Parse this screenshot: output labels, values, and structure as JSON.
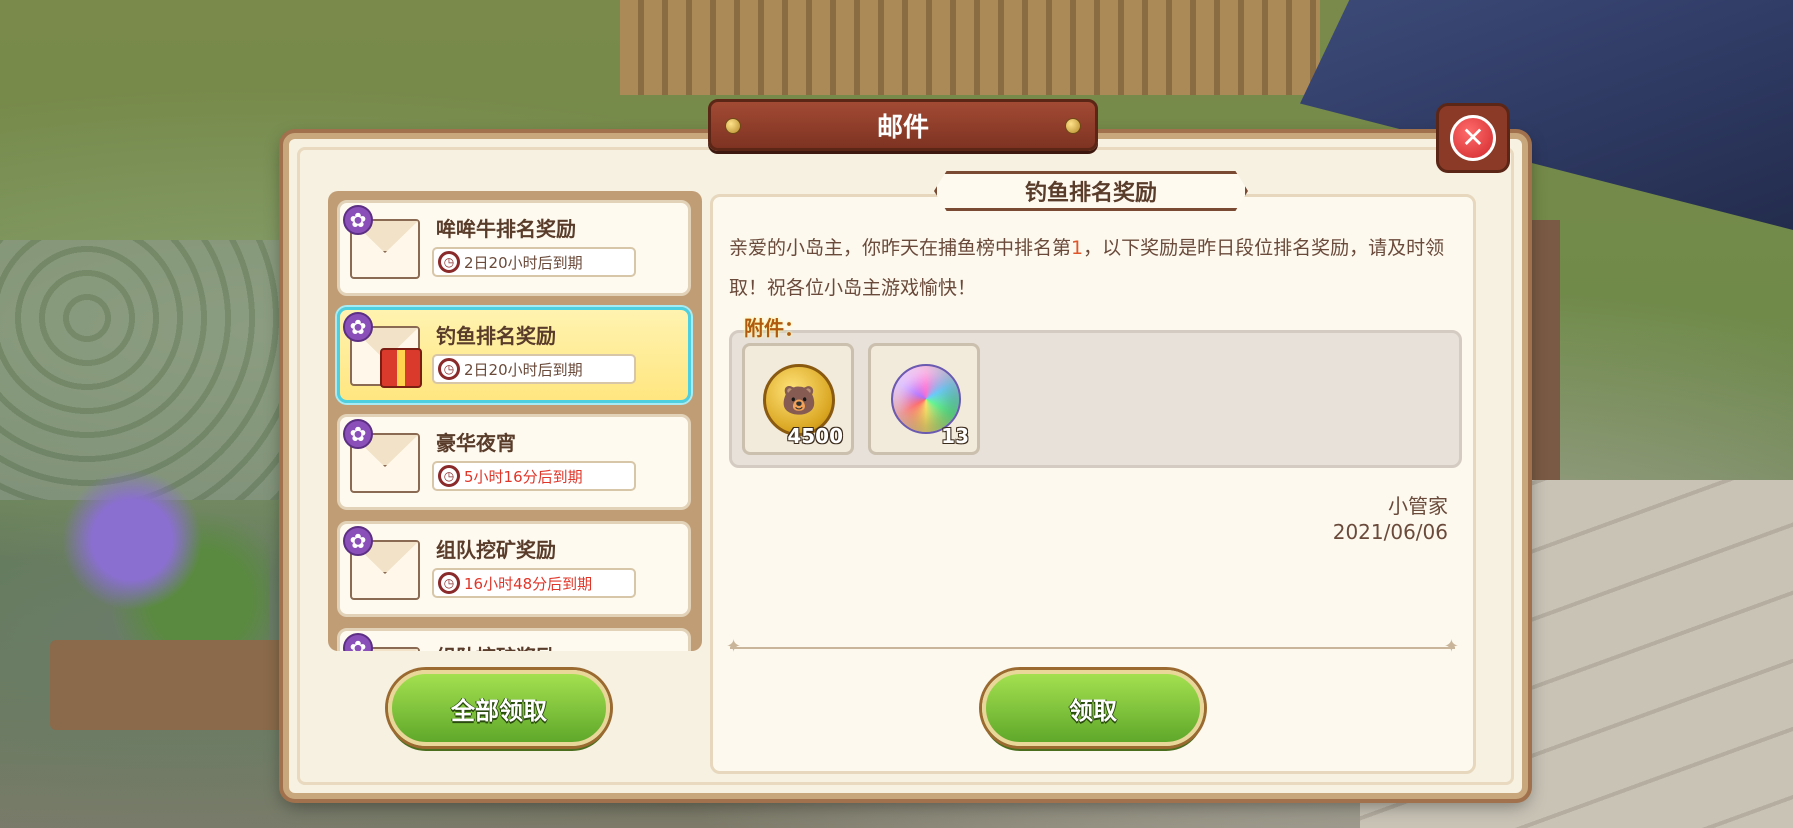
{
  "window": {
    "title": "邮件",
    "close_icon": "close-icon"
  },
  "mail_list": [
    {
      "name": "哞哞牛排名奖励",
      "expiry": "2日20小时后到期",
      "urgent": false,
      "icon": "envelope-icon",
      "selected": false
    },
    {
      "name": "钓鱼排名奖励",
      "expiry": "2日20小时后到期",
      "urgent": false,
      "icon": "gift-envelope-icon",
      "selected": true
    },
    {
      "name": "豪华夜宵",
      "expiry": "5小时16分后到期",
      "urgent": true,
      "icon": "envelope-icon",
      "selected": false
    },
    {
      "name": "组队挖矿奖励",
      "expiry": "16小时48分后到期",
      "urgent": true,
      "icon": "envelope-icon",
      "selected": false
    },
    {
      "name": "组队挖矿奖励",
      "expiry": "",
      "urgent": false,
      "icon": "envelope-icon",
      "selected": false
    }
  ],
  "actions": {
    "claim_all": "全部领取",
    "claim": "领取"
  },
  "detail": {
    "title": "钓鱼排名奖励",
    "body_part1": "亲爱的小岛主，你昨天在捕鱼榜中排名第",
    "rank": "1",
    "body_part2": "，以下奖励是昨日段位排名奖励，请及时领取！祝各位小岛主游戏愉快！",
    "attachment_label": "附件：",
    "attachments": [
      {
        "item": "gold-coin-icon",
        "quantity": "4500"
      },
      {
        "item": "rainbow-orb-icon",
        "quantity": "13"
      }
    ],
    "sender": "小管家",
    "date": "2021/06/06"
  },
  "colors": {
    "accent_green": "#6fbf2e",
    "selection_cyan": "#4fd0e0",
    "urgent_red": "#e0362a",
    "title_brown": "#8e3a26"
  }
}
